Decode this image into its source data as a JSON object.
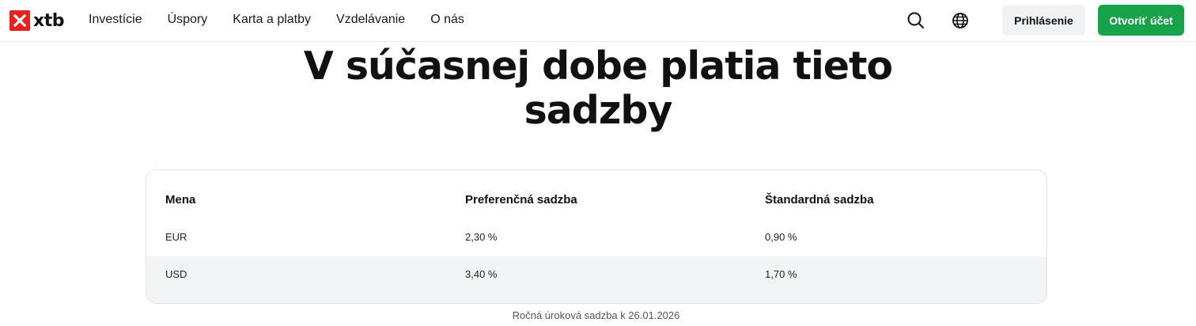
{
  "header": {
    "logo_text": "xtb",
    "brand_color": "#e8201e",
    "nav": [
      {
        "label": "Investície"
      },
      {
        "label": "Úspory"
      },
      {
        "label": "Karta a platby"
      },
      {
        "label": "Vzdelávanie"
      },
      {
        "label": "O nás"
      }
    ],
    "icons": [
      "search-icon",
      "globe-icon"
    ],
    "login_label": "Prihlásenie",
    "open_account_label": "Otvoriť účet",
    "accent_color": "#16a34a"
  },
  "main": {
    "heading": "V súčasnej dobe platia tieto sadzby",
    "table": {
      "columns": [
        "Mena",
        "Preferenčná sadzba",
        "Štandardná sadzba"
      ],
      "rows": [
        [
          "EUR",
          "2,30 %",
          "0,90 %"
        ],
        [
          "USD",
          "3,40 %",
          "1,70 %"
        ]
      ]
    },
    "footnote": "Ročná úroková sadzba k 26.01.2026"
  }
}
